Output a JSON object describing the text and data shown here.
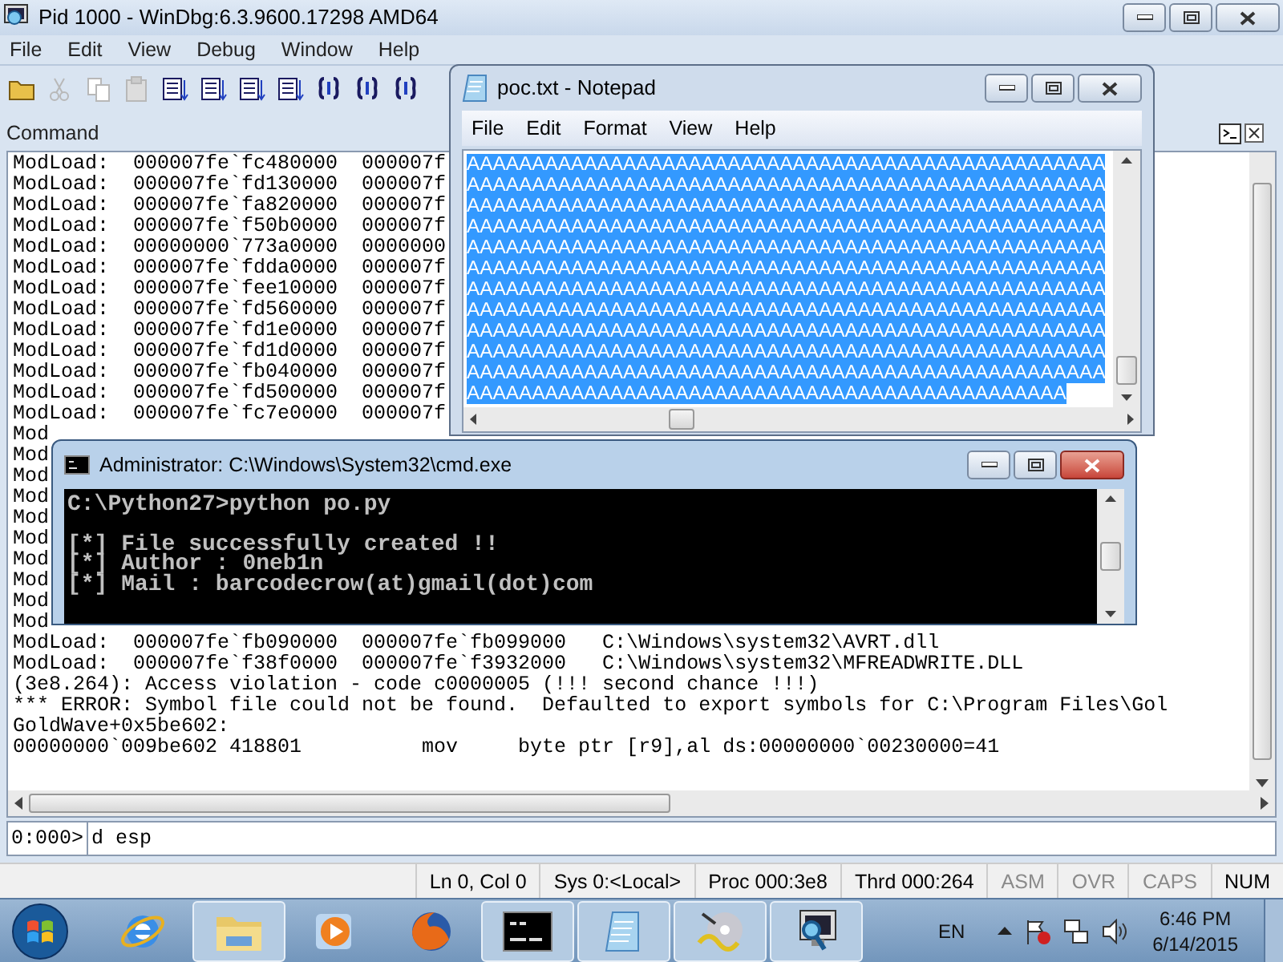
{
  "windbg": {
    "title": "Pid 1000 - WinDbg:6.3.9600.17298 AMD64",
    "menu": [
      "File",
      "Edit",
      "View",
      "Debug",
      "Window",
      "Help"
    ],
    "toolbar": [
      {
        "kind": "folder",
        "disabled": false
      },
      {
        "kind": "scissors",
        "disabled": true
      },
      {
        "kind": "copy",
        "disabled": true
      },
      {
        "kind": "paste",
        "disabled": true
      },
      {
        "kind": "doc",
        "disabled": false
      },
      {
        "kind": "doc",
        "disabled": false
      },
      {
        "kind": "doc",
        "disabled": false
      },
      {
        "kind": "doc",
        "disabled": false
      },
      {
        "kind": "braces",
        "disabled": false
      },
      {
        "kind": "braces",
        "disabled": false
      },
      {
        "kind": "braces",
        "disabled": false
      }
    ],
    "command_pane": {
      "title": "Command",
      "lines": [
        "ModLoad:  000007fe`fc480000  000007f",
        "ModLoad:  000007fe`fd130000  000007f",
        "ModLoad:  000007fe`fa820000  000007f",
        "ModLoad:  000007fe`f50b0000  000007f",
        "ModLoad:  00000000`773a0000  0000000",
        "ModLoad:  000007fe`fdda0000  000007f",
        "ModLoad:  000007fe`fee10000  000007f",
        "ModLoad:  000007fe`fd560000  000007f",
        "ModLoad:  000007fe`fd1e0000  000007f",
        "ModLoad:  000007fe`fd1d0000  000007f",
        "ModLoad:  000007fe`fb040000  000007f",
        "ModLoad:  000007fe`fd500000  000007f",
        "ModLoad:  000007fe`fc7e0000  000007f",
        "Mod",
        "Mod",
        "Mod",
        "Mod",
        "Mod",
        "Mod",
        "Mod",
        "Mod",
        "Mod",
        "Mod",
        "ModLoad:  000007fe`fb090000  000007fe`fb099000   C:\\Windows\\system32\\AVRT.dll",
        "ModLoad:  000007fe`f38f0000  000007fe`f3932000   C:\\Windows\\system32\\MFREADWRITE.DLL",
        "(3e8.264): Access violation - code c0000005 (!!! second chance !!!)",
        "*** ERROR: Symbol file could not be found.  Defaulted to export symbols for C:\\Program Files\\Gol",
        "GoldWave+0x5be602:",
        "00000000`009be602 418801          mov     byte ptr [r9],al ds:00000000`00230000=41"
      ]
    },
    "prompt": "0:000>",
    "command_input": {
      "value": "d esp"
    },
    "status_bar": [
      {
        "text": "Ln 0, Col 0",
        "enabled": true
      },
      {
        "text": "Sys 0:<Local>",
        "enabled": true
      },
      {
        "text": "Proc 000:3e8",
        "enabled": true
      },
      {
        "text": "Thrd 000:264",
        "enabled": true
      },
      {
        "text": "ASM",
        "enabled": false
      },
      {
        "text": "OVR",
        "enabled": false
      },
      {
        "text": "CAPS",
        "enabled": false
      },
      {
        "text": "NUM",
        "enabled": true
      }
    ]
  },
  "notepad": {
    "title": "poc.txt - Notepad",
    "menu": [
      "File",
      "Edit",
      "Format",
      "View",
      "Help"
    ],
    "text_selected": true,
    "lines": [
      "AAAAAAAAAAAAAAAAAAAAAAAAAAAAAAAAAAAAAAAAAAAAAAAAA",
      "AAAAAAAAAAAAAAAAAAAAAAAAAAAAAAAAAAAAAAAAAAAAAAAAA",
      "AAAAAAAAAAAAAAAAAAAAAAAAAAAAAAAAAAAAAAAAAAAAAAAAA",
      "AAAAAAAAAAAAAAAAAAAAAAAAAAAAAAAAAAAAAAAAAAAAAAAAA",
      "AAAAAAAAAAAAAAAAAAAAAAAAAAAAAAAAAAAAAAAAAAAAAAAAA",
      "AAAAAAAAAAAAAAAAAAAAAAAAAAAAAAAAAAAAAAAAAAAAAAAAA",
      "AAAAAAAAAAAAAAAAAAAAAAAAAAAAAAAAAAAAAAAAAAAAAAAAA",
      "AAAAAAAAAAAAAAAAAAAAAAAAAAAAAAAAAAAAAAAAAAAAAAAAA",
      "AAAAAAAAAAAAAAAAAAAAAAAAAAAAAAAAAAAAAAAAAAAAAAAAA",
      "AAAAAAAAAAAAAAAAAAAAAAAAAAAAAAAAAAAAAAAAAAAAAAAAA",
      "AAAAAAAAAAAAAAAAAAAAAAAAAAAAAAAAAAAAAAAAAAAAAAAAA",
      "AAAAAAAAAAAAAAAAAAAAAAAAAAAAAAAAAAAAAAAAAAAAAA"
    ]
  },
  "cmd": {
    "title": "Administrator: C:\\Windows\\System32\\cmd.exe",
    "lines": [
      "C:\\Python27>python po.py",
      "[*] File successfully created !!",
      "[*] Author : 0neb1n",
      "[*] Mail : barcodecrow(at)gmail(dot)com"
    ]
  },
  "taskbar": {
    "apps": [
      {
        "kind": "browser",
        "running": false
      },
      {
        "kind": "folder",
        "running": true
      },
      {
        "kind": "media",
        "running": false
      },
      {
        "kind": "fox",
        "running": false
      },
      {
        "kind": "terminal",
        "running": true
      },
      {
        "kind": "notepad",
        "running": true
      },
      {
        "kind": "disc",
        "running": true
      },
      {
        "kind": "monitor",
        "running": true
      }
    ],
    "language": "EN",
    "time": "6:46 PM",
    "date": "6/14/2015"
  }
}
